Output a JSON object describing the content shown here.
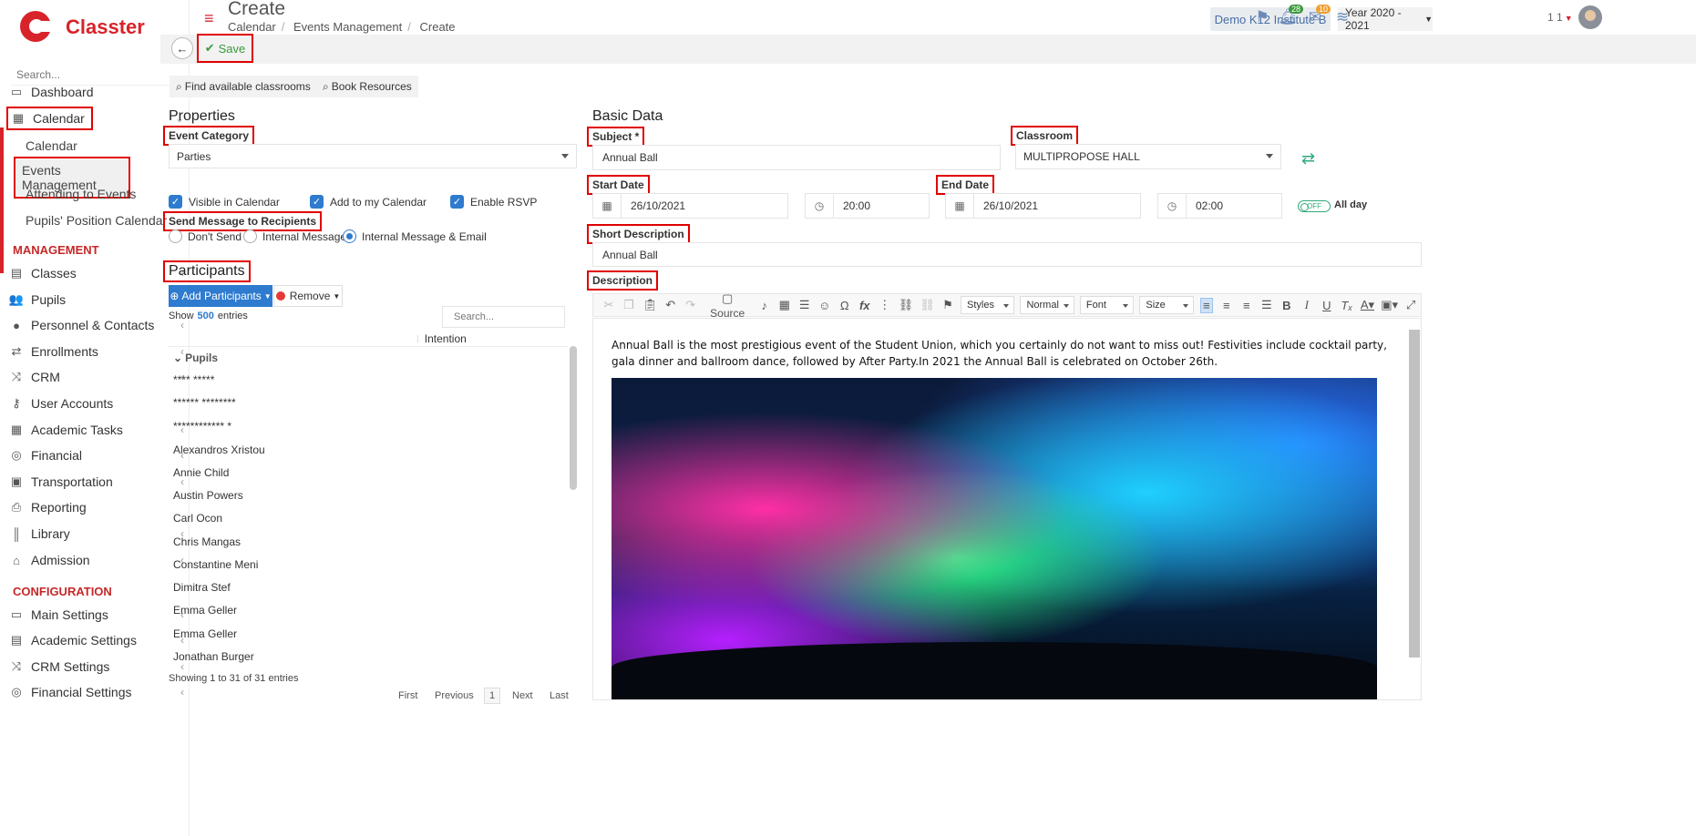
{
  "brand": {
    "name": "Classter"
  },
  "sidebar": {
    "search_placeholder": "Search...",
    "items_top": [
      {
        "label": "Dashboard",
        "icon": "monitor-icon"
      },
      {
        "label": "Calendar",
        "icon": "calendar-icon"
      }
    ],
    "calendar_sub": [
      "Calendar",
      "Events Management",
      "Attending to Events",
      "Pupils' Position Calendar"
    ],
    "section_management": "MANAGEMENT",
    "management": [
      "Classes",
      "Pupils",
      "Personnel & Contacts",
      "Enrollments",
      "CRM",
      "User Accounts",
      "Academic Tasks",
      "Financial",
      "Transportation",
      "Reporting",
      "Library",
      "Admission"
    ],
    "section_configuration": "CONFIGURATION",
    "configuration": [
      "Main Settings",
      "Academic Settings",
      "CRM Settings",
      "Financial Settings"
    ]
  },
  "header": {
    "title": "Create",
    "breadcrumb": [
      "Calendar",
      "Events Management",
      "Create"
    ],
    "institute": "Demo K12 Institute B",
    "year": "Year 2020 - 2021",
    "notifications_count": "28",
    "messages_count": "10",
    "user_label": "1 1"
  },
  "toolbar": {
    "save_label": "Save"
  },
  "actions": {
    "find_classrooms": "Find available classrooms",
    "book_resources": "Book Resources"
  },
  "properties": {
    "title": "Properties",
    "event_category_label": "Event Category",
    "event_category_value": "Parties",
    "checkboxes": [
      "Visible in Calendar",
      "Add to my Calendar",
      "Enable RSVP"
    ],
    "send_message_label": "Send Message to Recipients",
    "radios": [
      "Don't Send",
      "Internal Message",
      "Internal Message & Email"
    ]
  },
  "participants": {
    "title": "Participants",
    "add_label": "Add Participants",
    "remove_label": "Remove",
    "show_prefix": "Show",
    "show_count": "500",
    "show_suffix": "entries",
    "search_placeholder": "Search...",
    "col_intention": "Intention",
    "group": "Pupils",
    "rows": [
      "**** *****",
      "****** ********",
      "************ *",
      "Alexandros Xristou",
      "Annie Child",
      "Austin Powers",
      "Carl Ocon",
      "Chris Mangas",
      "Constantine Meni",
      "Dimitra Stef",
      "Emma Geller",
      "Emma Geller",
      "Jonathan Burger"
    ],
    "info": "Showing 1 to 31 of 31 entries",
    "pager": {
      "first": "First",
      "previous": "Previous",
      "page": "1",
      "next": "Next",
      "last": "Last"
    }
  },
  "basic": {
    "title": "Basic Data",
    "subject_label": "Subject *",
    "subject_value": "Annual Ball",
    "classroom_label": "Classroom",
    "classroom_value": "MULTIPROPOSE HALL",
    "start_label": "Start Date",
    "start_date": "26/10/2021",
    "start_time": "20:00",
    "end_label": "End Date",
    "end_date": "26/10/2021",
    "end_time": "02:00",
    "toggle_text": "OFF",
    "all_day": "All day",
    "short_label": "Short Description",
    "short_value": "Annual Ball",
    "desc_label": "Description",
    "editor": {
      "source": "Source",
      "styles": "Styles",
      "format": "Normal",
      "font": "Font",
      "size": "Size",
      "text": "Annual Ball is the most prestigious event of the Student Union, which you certainly do not want to miss out! Festivities include cocktail party, gala dinner and ballroom dance, followed by After Party.In 2021 the Annual Ball is celebrated on October 26th."
    }
  },
  "colors": {
    "brand": "#d8232a",
    "primary": "#2e7bcf",
    "success": "#3a9a3a",
    "highlight": "#e00000"
  }
}
